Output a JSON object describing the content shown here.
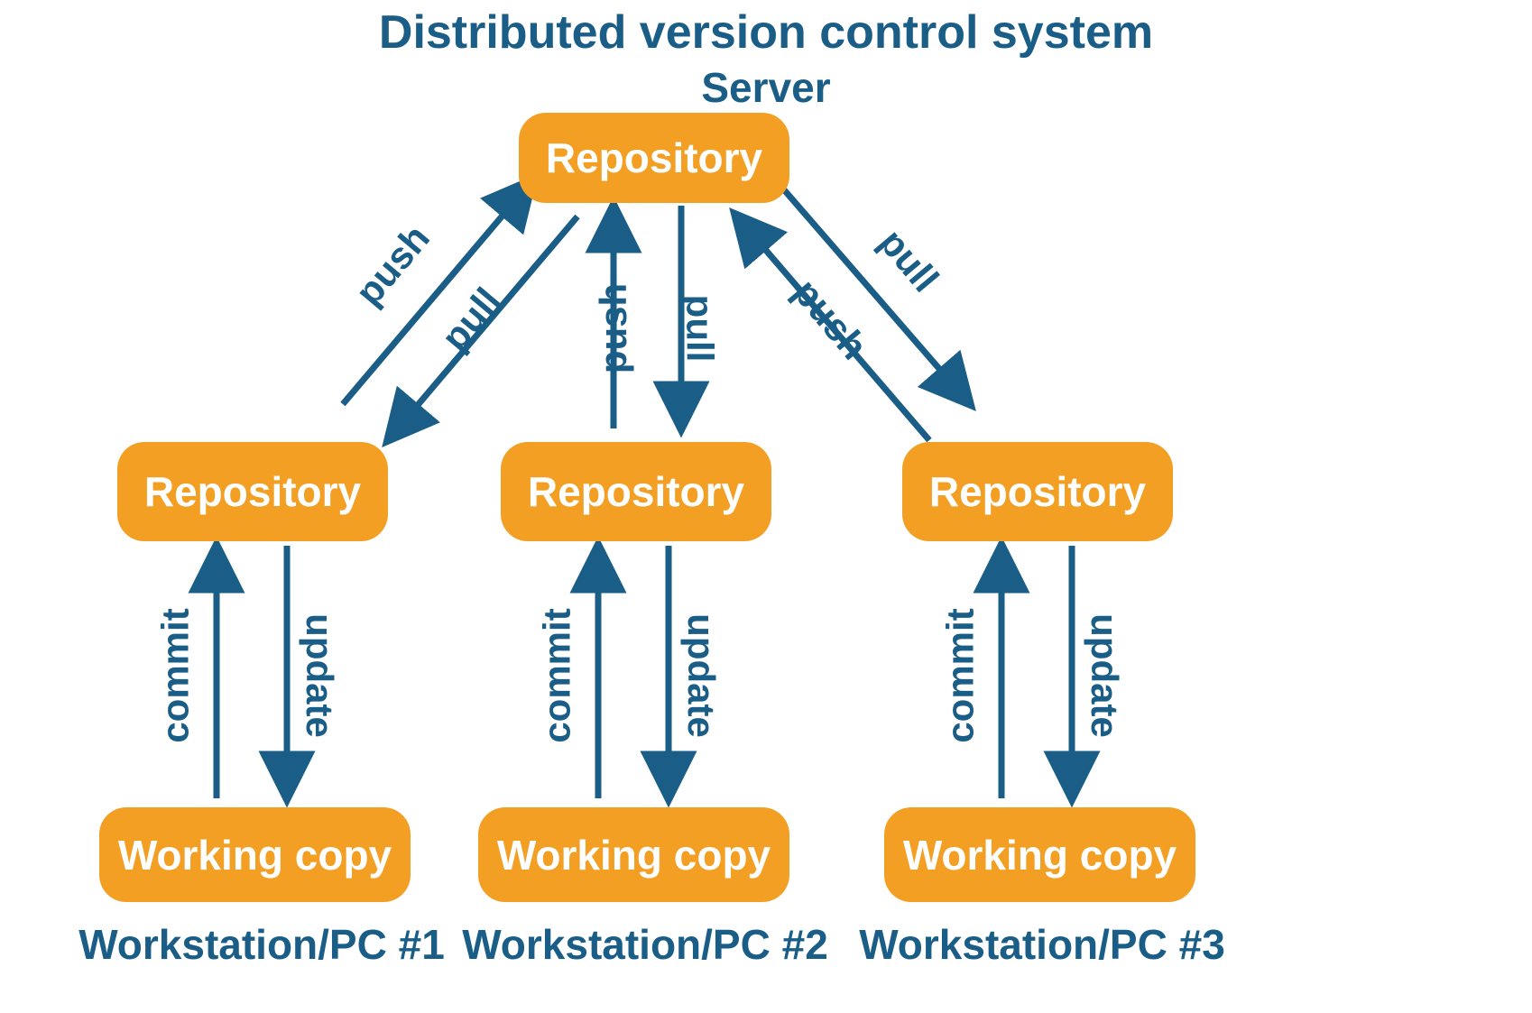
{
  "title": "Distributed version control system",
  "server_label": "Server",
  "nodes": {
    "server_repo": "Repository",
    "ws1_repo": "Repository",
    "ws2_repo": "Repository",
    "ws3_repo": "Repository",
    "ws1_wc": "Working copy",
    "ws2_wc": "Working copy",
    "ws3_wc": "Working copy"
  },
  "edges": {
    "push": "push",
    "pull": "pull",
    "commit": "commit",
    "update": "update"
  },
  "ws": {
    "l1": "Workstation/PC #1",
    "l2": "Workstation/PC #2",
    "l3": "Workstation/PC #3"
  },
  "colors": {
    "node": "#f29f24",
    "text": "#1a5d87",
    "arrow": "#1a5d87"
  }
}
